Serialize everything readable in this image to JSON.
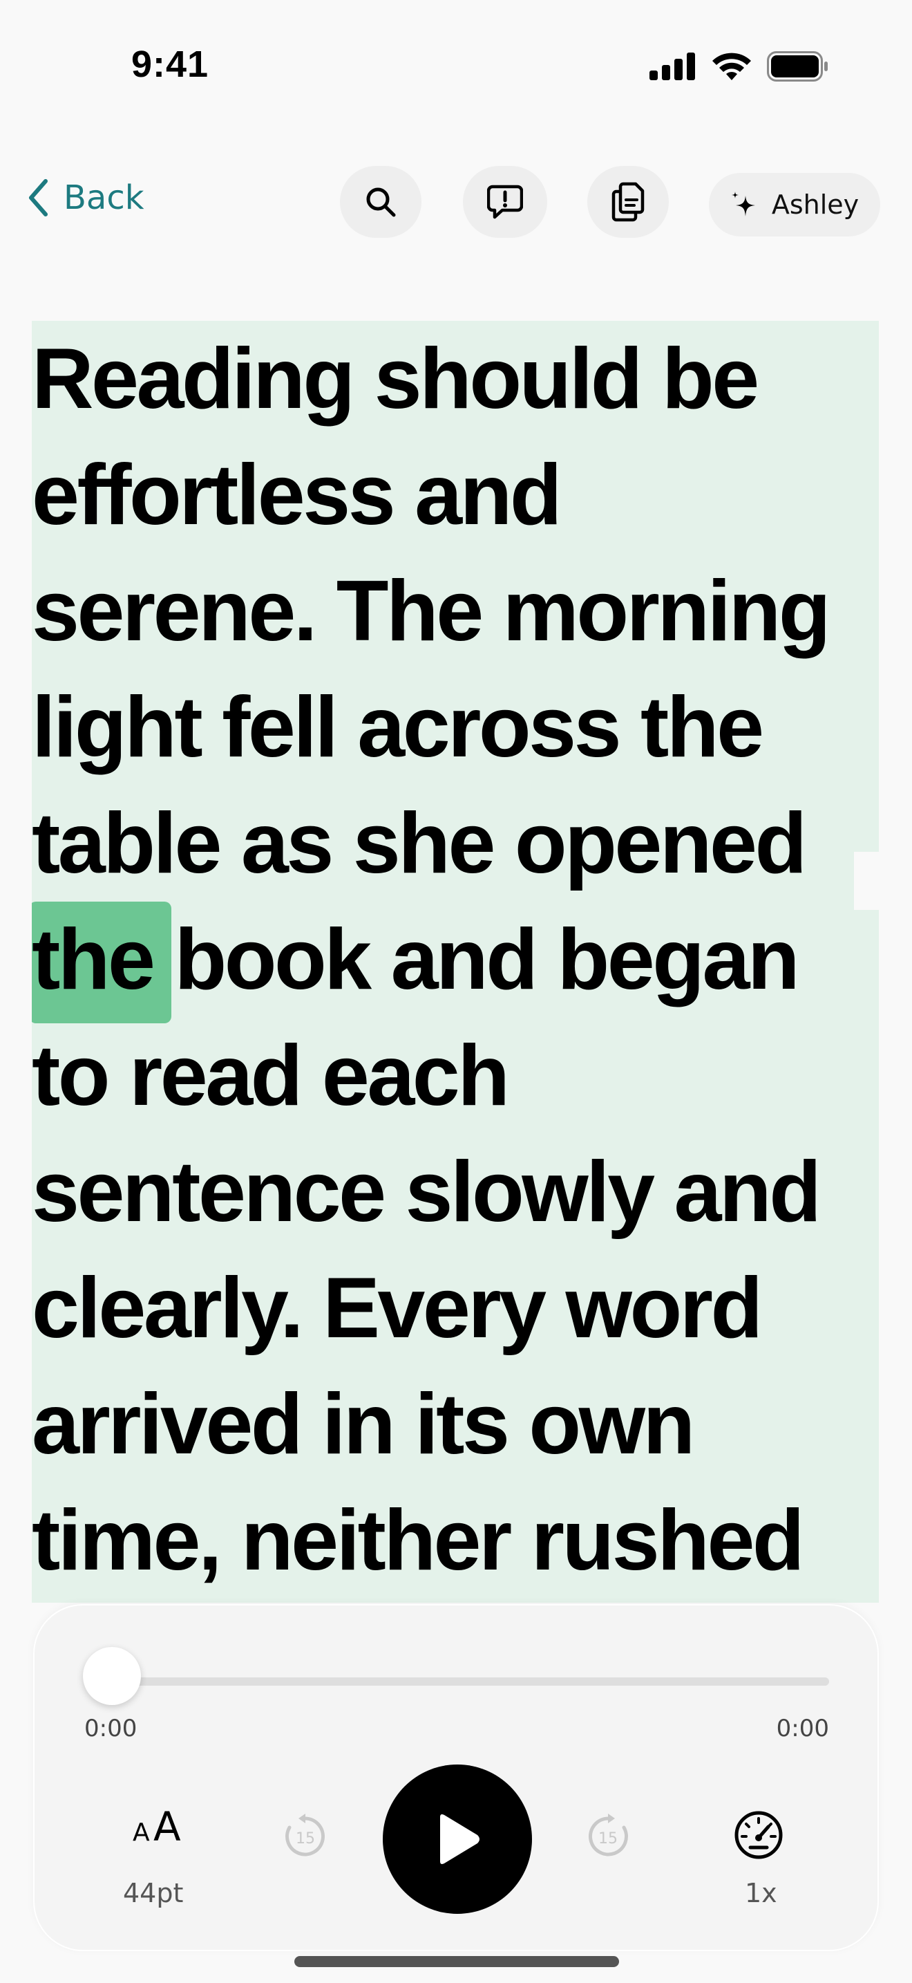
{
  "status_bar": {
    "time": "9:41"
  },
  "nav": {
    "back_label": "Back",
    "voice_label": "Ashley"
  },
  "reading": {
    "lines": [
      "Reading should be",
      "effortless and",
      "serene. The morning",
      "light fell across the",
      "table as she opened",
      "the book and began",
      "to read each",
      "sentence slowly and",
      "clearly. Every word",
      "arrived in its own",
      "time, neither rushed"
    ],
    "current_word": "the",
    "highlight_color": "#e4f2ea",
    "current_word_color": "#6cc693"
  },
  "player": {
    "elapsed": "0:00",
    "duration": "0:00",
    "progress": 0,
    "font_size_label": "44pt",
    "speed_label": "1x",
    "skip_back_seconds": "15",
    "skip_forward_seconds": "15"
  },
  "colors": {
    "accent": "#1d7a80",
    "background": "#f9f9f9"
  }
}
